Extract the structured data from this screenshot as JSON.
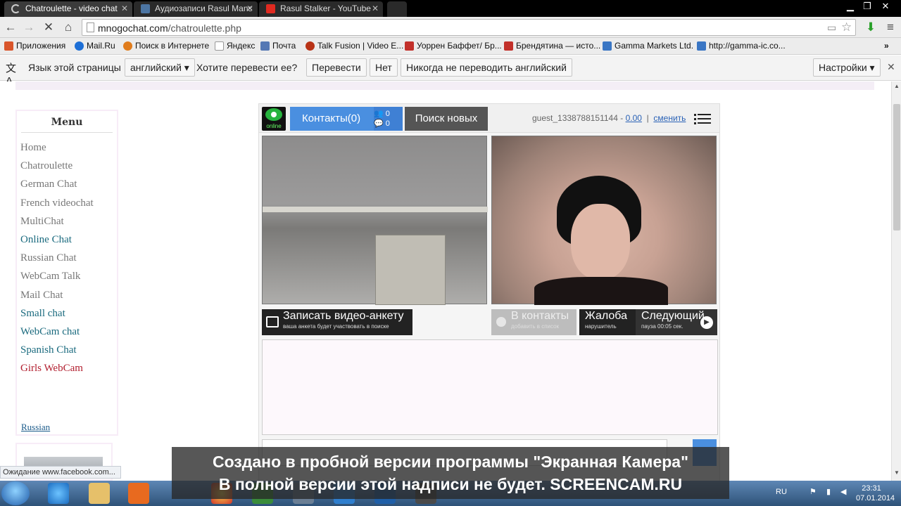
{
  "tabs": [
    {
      "title": "Chatroulette - video chat",
      "active": true
    },
    {
      "title": "Аудиозаписи Rasul Mans",
      "active": false
    },
    {
      "title": "Rasul Stalker - YouTube",
      "active": false
    }
  ],
  "toolbar": {
    "url_domain": "mnogochat.com",
    "url_path": "/chatroulette.php"
  },
  "bookmarks": [
    {
      "label": "Приложения",
      "icon": "apps-grid-icon",
      "color": "#d9552b"
    },
    {
      "label": "Mail.Ru",
      "icon": "mailru-icon",
      "color": "#1d6fd6"
    },
    {
      "label": "Поиск в Интернете",
      "icon": "search-web-icon",
      "color": "#e07c1c"
    },
    {
      "label": "Яндекс",
      "icon": "page-icon",
      "color": "#f5f5f5"
    },
    {
      "label": "Почта",
      "icon": "mail-icon",
      "color": "#5578b4"
    },
    {
      "label": "Talk Fusion | Video E...",
      "icon": "talkfusion-icon",
      "color": "#b83216"
    },
    {
      "label": "Уоррен Баффет/ Бр...",
      "icon": "pf-icon",
      "color": "#c2302a"
    },
    {
      "label": "Брендятина — исто...",
      "icon": "pf-icon",
      "color": "#c2302a"
    },
    {
      "label": "Gamma Markets Ltd.",
      "icon": "gamma-icon",
      "color": "#3a76c4"
    },
    {
      "label": "http://gamma-ic.co...",
      "icon": "gamma-icon",
      "color": "#3a76c4"
    }
  ],
  "translate": {
    "prompt": "Язык этой страницы",
    "language": "английский ▾",
    "question": "Хотите перевести ее?",
    "translate_btn": "Перевести",
    "no_btn": "Нет",
    "never_btn": "Никогда не переводить английский",
    "settings_btn": "Настройки ▾"
  },
  "menu": {
    "title": "Menu",
    "items": [
      {
        "label": "Home",
        "style": "gray"
      },
      {
        "label": "Chatroulette",
        "style": "gray"
      },
      {
        "label": "German Chat",
        "style": "gray"
      },
      {
        "label": "French videochat",
        "style": "gray"
      },
      {
        "label": "MultiChat",
        "style": "gray"
      },
      {
        "label": "Online Chat",
        "style": "teal"
      },
      {
        "label": "Russian Chat",
        "style": "gray"
      },
      {
        "label": "WebCam Talk",
        "style": "gray"
      },
      {
        "label": "Mail Chat",
        "style": "gray"
      },
      {
        "label": "Small chat",
        "style": "teal"
      },
      {
        "label": "WebCam chat",
        "style": "teal"
      },
      {
        "label": "Spanish Chat",
        "style": "teal"
      },
      {
        "label": "Girls WebCam",
        "style": "red"
      }
    ],
    "language_link": "Russian"
  },
  "chat": {
    "online_label": "online",
    "contacts_label": "Контакты(0)",
    "contacts_friends_count": "0",
    "contacts_messages_count": "0",
    "search_new_label": "Поиск новых",
    "guest_name": "guest_1338788151144",
    "guest_dash": " - ",
    "balance": "0.00",
    "change_link": "сменить",
    "record_title": "Записать видео-анкету",
    "record_sub": "ваша анкета будет участвовать в поиске",
    "add_contact_title": "В контакты",
    "add_contact_sub": "добавить в список",
    "complaint_title": "Жалоба",
    "complaint_sub": "нарушитель",
    "next_title": "Следующий",
    "next_sub": "пауза 00:05 сек."
  },
  "status_text": "Ожидание www.facebook.com...",
  "watermark": {
    "line1": "Создано в пробной версии программы \"Экранная Камера\"",
    "line2": "В полной версии этой надписи не будет. SCREENCAM.RU"
  },
  "tray": {
    "lang": "RU",
    "time": "23:31",
    "date": "07.01.2014"
  },
  "colors": {
    "accent_blue": "#4a8fe0",
    "online_green": "#26b33e",
    "menu_teal": "#1a6a7e",
    "menu_red": "#b22030"
  }
}
